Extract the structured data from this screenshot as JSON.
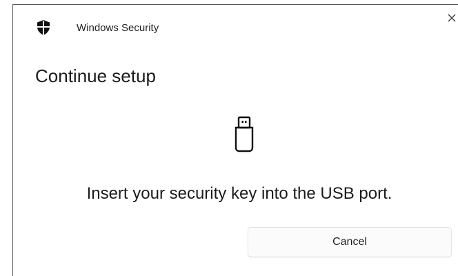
{
  "window": {
    "app_title": "Windows Security",
    "app_icon": "shield-icon",
    "close_icon": "close-icon"
  },
  "dialog": {
    "heading": "Continue setup",
    "illustration_icon": "usb-key-icon",
    "message": "Insert your security key into the USB port.",
    "cancel_label": "Cancel"
  },
  "colors": {
    "background": "#ffffff",
    "text": "#1b1b1b",
    "button_background": "#fbfbfb",
    "button_border": "#e2e2e2"
  }
}
